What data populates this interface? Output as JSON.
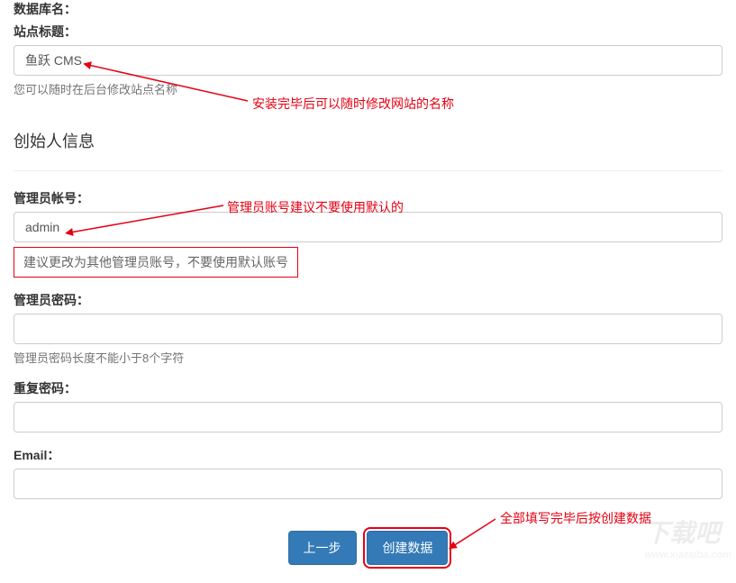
{
  "labels": {
    "database_name": "数据库名：",
    "site_title": "站点标题：",
    "admin_account": "管理员帐号：",
    "admin_password": "管理员密码：",
    "repeat_password": "重复密码：",
    "email": "Email："
  },
  "values": {
    "site_title": "鱼跃 CMS",
    "admin_account": "admin"
  },
  "help": {
    "site_title": "您可以随时在后台修改站点名称",
    "admin_account_box": "建议更改为其他管理员账号，不要使用默认账号",
    "admin_password": "管理员密码长度不能小于8个字符"
  },
  "section": {
    "founder_info": "创始人信息"
  },
  "annotations": {
    "site_title": "安装完毕后可以随时修改网站的名称",
    "admin_account": "管理员账号建议不要使用默认的",
    "create_data": "全部填写完毕后按创建数据"
  },
  "buttons": {
    "prev": "上一步",
    "create": "创建数据"
  },
  "watermark": {
    "main": "下载吧",
    "sub": "www.xiazaiba.com"
  }
}
